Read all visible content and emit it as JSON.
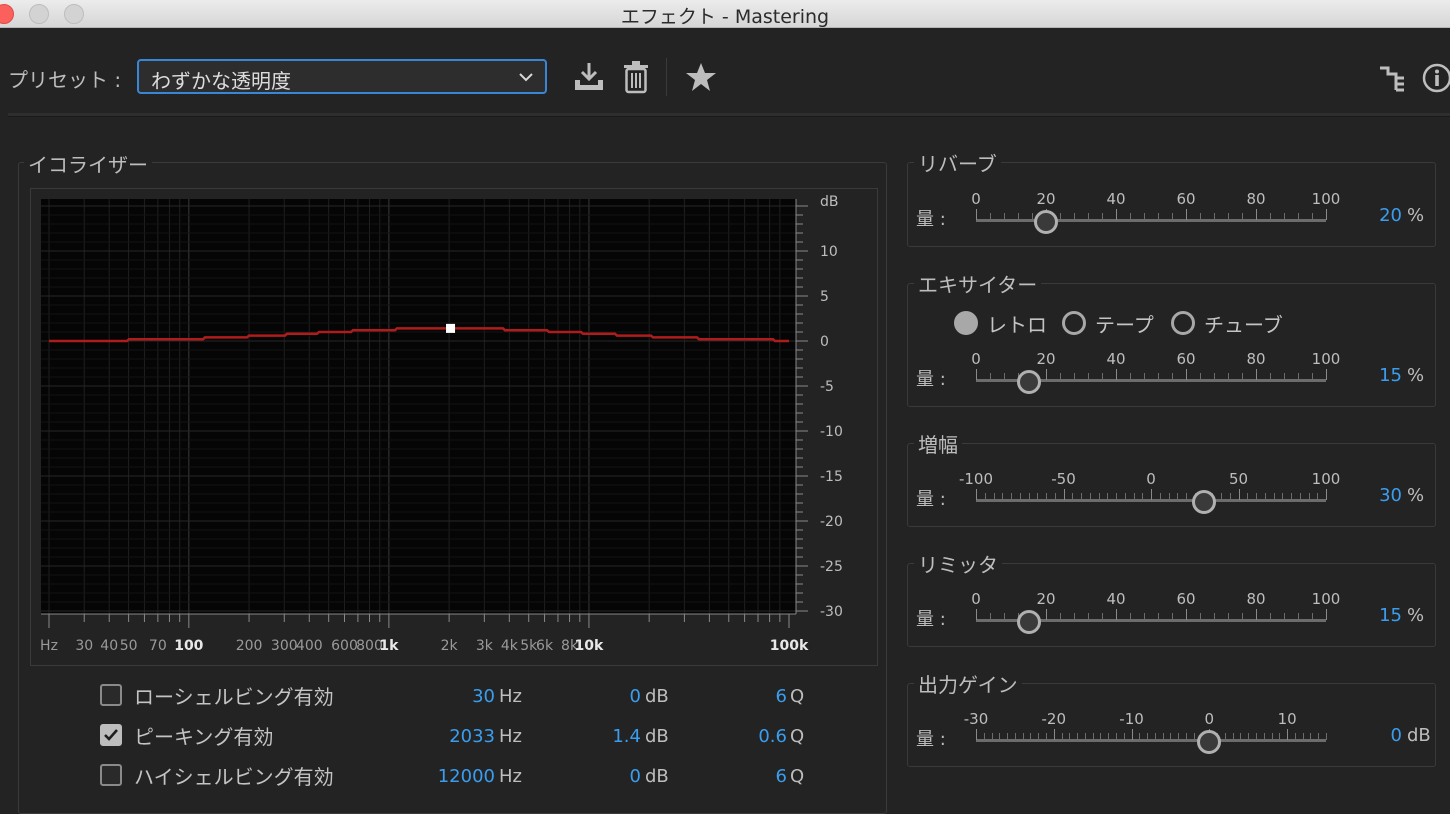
{
  "window": {
    "title": "エフェクト - Mastering"
  },
  "toolbar": {
    "preset_label": "プリセット :",
    "preset_value": "わずかな透明度",
    "icons": [
      "download-icon",
      "trash-icon",
      "star-icon",
      "routing-icon",
      "info-icon"
    ]
  },
  "equalizer": {
    "title": "イコライザー",
    "db_unit": "dB",
    "db_ticks": [
      "10",
      "5",
      "0",
      "-5",
      "-10",
      "-15",
      "-20",
      "-25",
      "-30"
    ],
    "freq_ticks": [
      "Hz",
      "30",
      "40",
      "50",
      "70",
      "100",
      "200",
      "300",
      "400",
      "600",
      "800",
      "1k",
      "2k",
      "3k",
      "4k",
      "5k",
      "6k",
      "8k",
      "10k",
      "100k"
    ],
    "curve_color": "#b01c1c",
    "bands": [
      {
        "label": "ローシェルビング有効",
        "checked": false,
        "freq": "30",
        "freq_unit": "Hz",
        "gain": "0",
        "gain_unit": "dB",
        "q": "6",
        "q_unit": "Q"
      },
      {
        "label": "ピーキング有効",
        "checked": true,
        "freq": "2033",
        "freq_unit": "Hz",
        "gain": "1.4",
        "gain_unit": "dB",
        "q": "0.6",
        "q_unit": "Q"
      },
      {
        "label": "ハイシェルビング有効",
        "checked": false,
        "freq": "12000",
        "freq_unit": "Hz",
        "gain": "0",
        "gain_unit": "dB",
        "q": "6",
        "q_unit": "Q"
      }
    ]
  },
  "reverb": {
    "title": "リバーブ",
    "amount_label": "量 :",
    "ticks": [
      "0",
      "20",
      "40",
      "60",
      "80",
      "100"
    ],
    "value": "20",
    "unit": "%",
    "min": 0,
    "max": 100,
    "level": 20
  },
  "exciter": {
    "title": "エキサイター",
    "modes": [
      {
        "label": "レトロ",
        "selected": true
      },
      {
        "label": "テープ",
        "selected": false
      },
      {
        "label": "チューブ",
        "selected": false
      }
    ],
    "amount_label": "量 :",
    "ticks": [
      "0",
      "20",
      "40",
      "60",
      "80",
      "100"
    ],
    "value": "15",
    "unit": "%",
    "min": 0,
    "max": 100,
    "level": 15
  },
  "widener": {
    "title": "増幅",
    "amount_label": "量 :",
    "ticks": [
      "-100",
      "-50",
      "0",
      "50",
      "100"
    ],
    "value": "30",
    "unit": "%",
    "min": -100,
    "max": 100,
    "level": 30
  },
  "limiter": {
    "title": "リミッタ",
    "amount_label": "量 :",
    "ticks": [
      "0",
      "20",
      "40",
      "60",
      "80",
      "100"
    ],
    "value": "15",
    "unit": "%",
    "min": 0,
    "max": 100,
    "level": 15
  },
  "output_gain": {
    "title": "出力ゲイン",
    "amount_label": "量 :",
    "ticks": [
      "-30",
      "-20",
      "-10",
      "0",
      "10"
    ],
    "value": "0",
    "unit": "dB",
    "min": -30,
    "max": 15,
    "level": 0
  },
  "colors": {
    "accent_blue": "#3a9ef0",
    "focus_border": "#3a86d6"
  }
}
